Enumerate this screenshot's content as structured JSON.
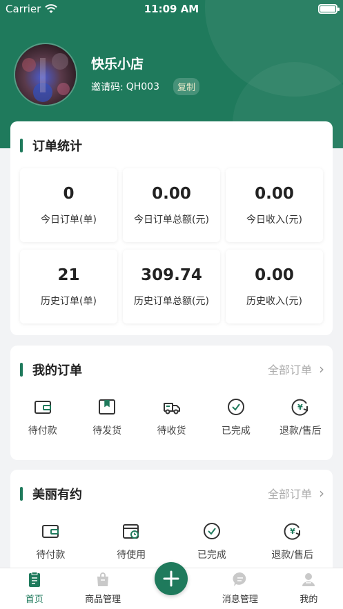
{
  "status_bar": {
    "carrier": "Carrier",
    "time": "11:09 AM"
  },
  "profile": {
    "shop_name": "快乐小店",
    "invite_label": "邀请码:",
    "invite_code": "QH003",
    "copy_label": "复制"
  },
  "order_stats": {
    "title": "订单统计",
    "items": [
      {
        "value": "0",
        "label": "今日订单(单)"
      },
      {
        "value": "0.00",
        "label": "今日订单总额(元)"
      },
      {
        "value": "0.00",
        "label": "今日收入(元)"
      },
      {
        "value": "21",
        "label": "历史订单(单)"
      },
      {
        "value": "309.74",
        "label": "历史订单总额(元)"
      },
      {
        "value": "0.00",
        "label": "历史收入(元)"
      }
    ]
  },
  "my_orders": {
    "title": "我的订单",
    "more_label": "全部订单",
    "items": [
      {
        "label": "待付款",
        "icon": "wallet-icon"
      },
      {
        "label": "待发货",
        "icon": "package-icon"
      },
      {
        "label": "待收货",
        "icon": "truck-icon"
      },
      {
        "label": "已完成",
        "icon": "check-circle-icon"
      },
      {
        "label": "退款/售后",
        "icon": "refund-icon"
      }
    ]
  },
  "beauty": {
    "title": "美丽有约",
    "more_label": "全部订单",
    "items": [
      {
        "label": "待付款",
        "icon": "wallet-icon"
      },
      {
        "label": "待使用",
        "icon": "calendar-clock-icon"
      },
      {
        "label": "已完成",
        "icon": "check-circle-icon"
      },
      {
        "label": "退款/售后",
        "icon": "refund-icon"
      }
    ]
  },
  "tabbar": {
    "items": [
      {
        "label": "首页",
        "icon": "home-clipboard-icon",
        "active": true
      },
      {
        "label": "商品管理",
        "icon": "bag-icon",
        "active": false
      },
      {
        "label": "消息管理",
        "icon": "chat-icon",
        "active": false
      },
      {
        "label": "我的",
        "icon": "user-icon",
        "active": false
      }
    ],
    "fab_icon": "plus-icon"
  },
  "colors": {
    "primary": "#1f7a5c",
    "background": "#f2f3f5"
  }
}
